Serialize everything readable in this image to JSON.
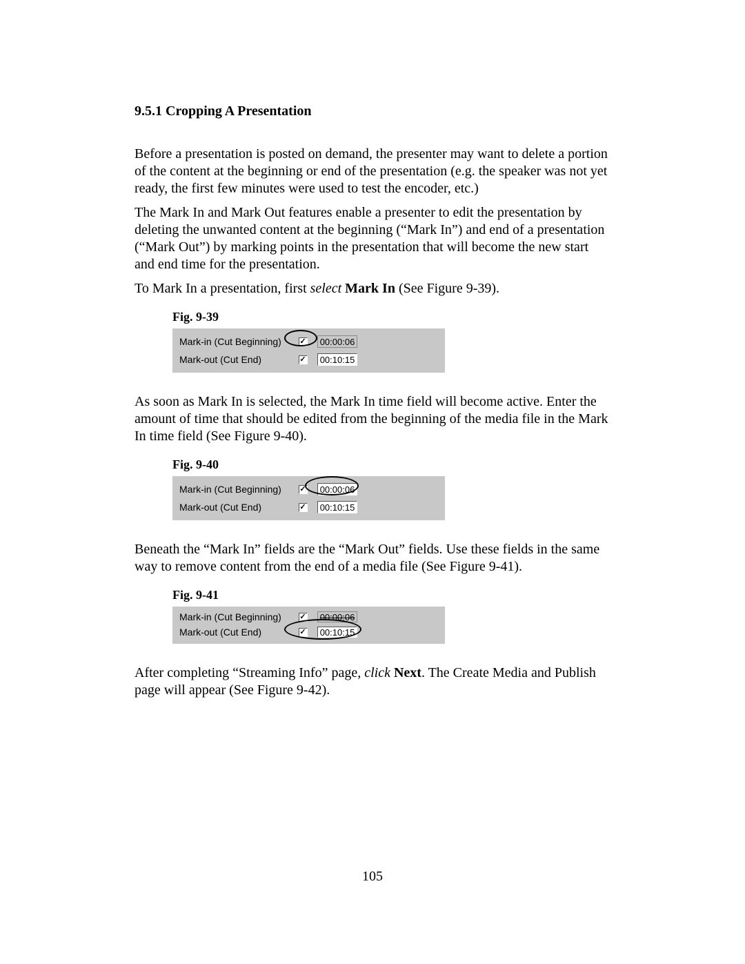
{
  "heading": "9.5.1 Cropping A Presentation",
  "para1": "Before a presentation is posted on demand, the presenter may want to delete a portion of the content at the beginning or end of the presentation (e.g. the speaker was not yet ready, the first few minutes were used to test the encoder, etc.)",
  "para2": "The Mark In and Mark Out features enable a presenter to edit the presentation by deleting the unwanted content at the beginning (“Mark In”) and end of a presentation (“Mark Out”) by marking points in the presentation that will become the new start and end time for the presentation.",
  "para3_a": "To Mark In a presentation, first ",
  "para3_sel": "select",
  "para3_b": " ",
  "para3_mi": "Mark In",
  "para3_c": " (See Figure 9-39).",
  "fig39_caption": "Fig.  9-39",
  "fig39": {
    "markin_label": "Mark-in (Cut Beginning)",
    "markout_label": "Mark-out (Cut End)",
    "markin_time": "00:00:06",
    "markout_time": "00:10:15"
  },
  "para4": "As soon as Mark In is selected, the Mark In time field will become active.  Enter the amount of time that should be edited from the beginning of the media file in the Mark In time field (See Figure 9-40).",
  "fig40_caption": "Fig. 9-40",
  "fig40": {
    "markin_label": "Mark-in (Cut Beginning)",
    "markout_label": "Mark-out (Cut End)",
    "markin_time": "00:00:06",
    "markout_time": "00:10:15"
  },
  "para5": "Beneath the “Mark In” fields are the “Mark Out” fields.  Use these fields in the same way to remove content from the end of a media file (See Figure 9-41).",
  "fig41_caption": "Fig.  9-41",
  "fig41": {
    "markin_label": "Mark-in (Cut Beginning)",
    "markout_label": "Mark-out (Cut End)",
    "markin_time": "00:00:06",
    "markout_time": "00:10:15"
  },
  "para6_a": "After completing “Streaming Info” page, ",
  "para6_click": "click",
  "para6_b": " ",
  "para6_next": "Next",
  "para6_c": ".   The Create Media and Publish page will appear (See Figure 9-42).",
  "page_number": "105",
  "check": "✓"
}
